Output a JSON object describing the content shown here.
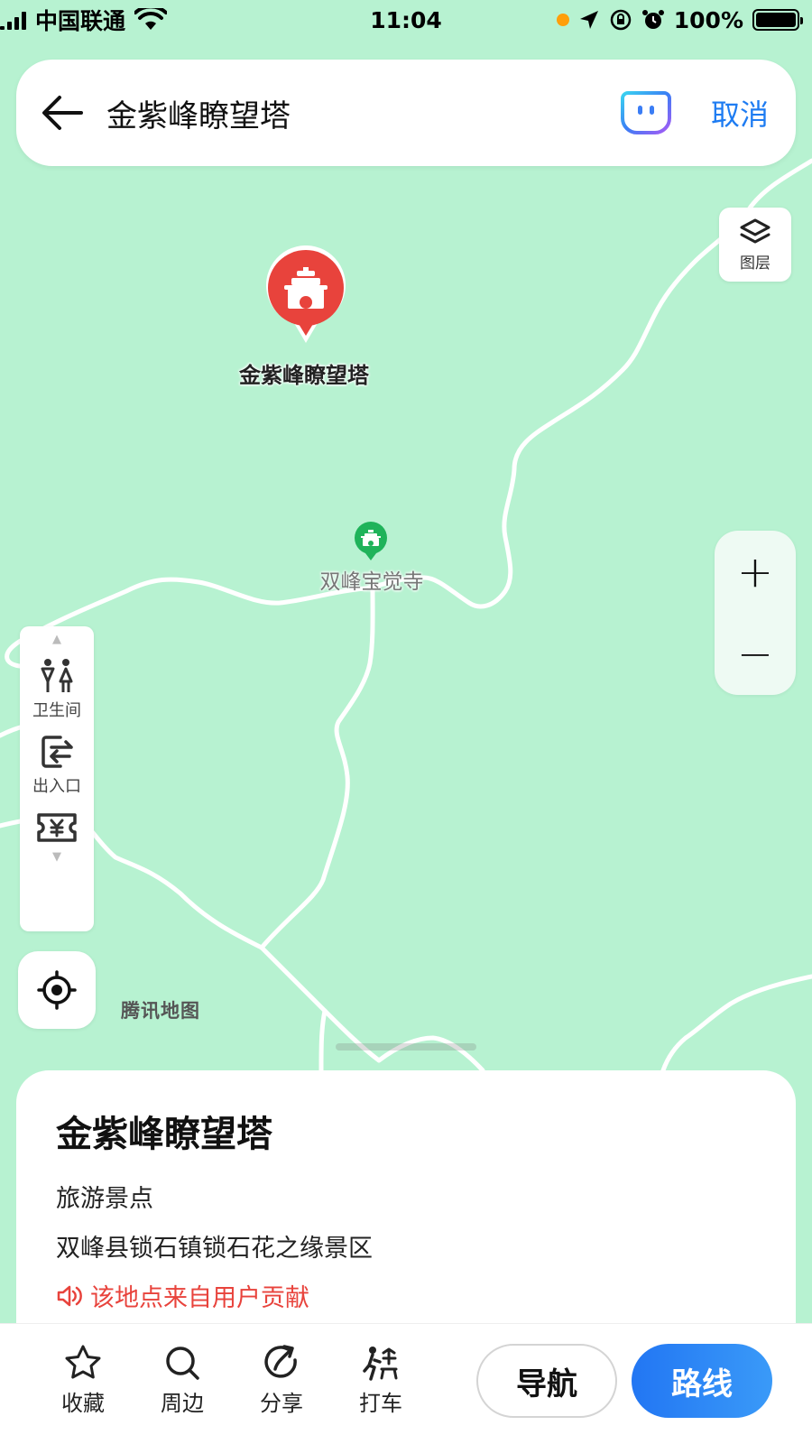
{
  "status_bar": {
    "carrier": "中国联通",
    "time": "11:04",
    "battery": "100%"
  },
  "search": {
    "query": "金紫峰瞭望塔",
    "cancel_label": "取消"
  },
  "map": {
    "layers_label": "图层",
    "zoom_in": "+",
    "zoom_out": "−",
    "facilities": [
      {
        "label": "卫生间",
        "icon": "restroom-icon"
      },
      {
        "label": "出入口",
        "icon": "entrance-icon"
      },
      {
        "label": "",
        "icon": "ticket-icon"
      }
    ],
    "brand": "腾讯地图",
    "main_poi_label": "金紫峰瞭望塔",
    "nearby_poi_label": "双峰宝觉寺"
  },
  "place": {
    "name": "金紫峰瞭望塔",
    "category": "旅游景点",
    "address": "双峰县锁石镇锁石花之缘景区",
    "note": "该地点来自用户贡献"
  },
  "toolbar": {
    "items": [
      {
        "label": "收藏",
        "icon": "star-icon"
      },
      {
        "label": "周边",
        "icon": "search-icon"
      },
      {
        "label": "分享",
        "icon": "share-icon"
      },
      {
        "label": "打车",
        "icon": "taxi-icon"
      }
    ],
    "nav_label": "导航",
    "route_label": "路线"
  },
  "colors": {
    "map_bg": "#b7f2d1",
    "accent_blue": "#1e7cf2",
    "marker_red": "#e8433c",
    "temple_green": "#1fb35a"
  }
}
